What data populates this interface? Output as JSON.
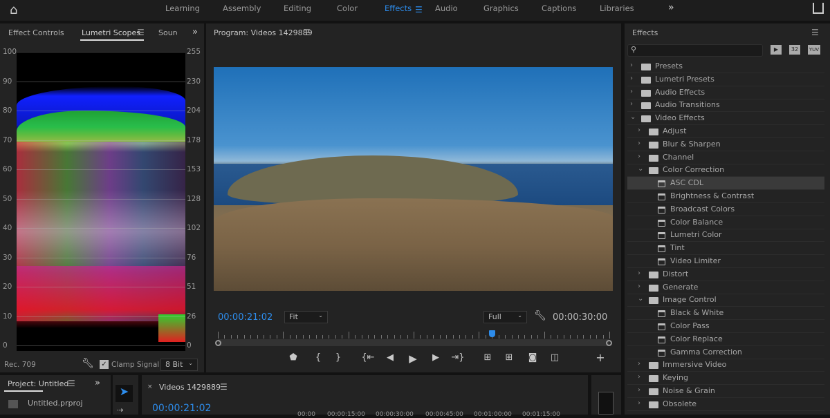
{
  "topbar": {
    "workspaces": [
      "Learning",
      "Assembly",
      "Editing",
      "Color",
      "Effects",
      "Audio",
      "Graphics",
      "Captions",
      "Libraries"
    ],
    "active": "Effects",
    "overflow": "»"
  },
  "left_panel": {
    "tabs": [
      "Effect Controls",
      "Lumetri Scopes",
      "Sourc"
    ],
    "active_tab": "Lumetri Scopes",
    "left_axis": [
      "100",
      "90",
      "80",
      "70",
      "60",
      "50",
      "40",
      "30",
      "20",
      "10",
      "0"
    ],
    "right_axis": [
      "255",
      "230",
      "204",
      "178",
      "153",
      "128",
      "102",
      "76",
      "51",
      "26",
      "0"
    ],
    "colorspace": "Rec. 709",
    "clamp_label": "Clamp Signal",
    "clamp_checked": true,
    "bit_depth": "8 Bit"
  },
  "program": {
    "title": "Program: Videos 1429889",
    "current_time": "00:00:21:02",
    "zoom": "Fit",
    "quality": "Full",
    "duration": "00:00:30:00",
    "playhead_fraction": 0.7
  },
  "project": {
    "title": "Project: Untitled",
    "file": "Untitled.prproj"
  },
  "timeline": {
    "title": "Videos 1429889",
    "timecode": "00:00:21:02",
    "ruler": [
      "00:00",
      "00:00:15:00",
      "00:00:30:00",
      "00:00:45:00",
      "00:01:00:00",
      "00:01:15:00"
    ]
  },
  "effects": {
    "title": "Effects",
    "badges": [
      "32",
      "YUV"
    ],
    "items": [
      {
        "label": "Presets",
        "level": 0,
        "type": "star-folder",
        "open": false
      },
      {
        "label": "Lumetri Presets",
        "level": 0,
        "type": "star-folder",
        "open": false
      },
      {
        "label": "Audio Effects",
        "level": 0,
        "type": "folder",
        "open": false
      },
      {
        "label": "Audio Transitions",
        "level": 0,
        "type": "folder",
        "open": false
      },
      {
        "label": "Video Effects",
        "level": 0,
        "type": "folder",
        "open": true
      },
      {
        "label": "Adjust",
        "level": 1,
        "type": "folder",
        "open": false
      },
      {
        "label": "Blur & Sharpen",
        "level": 1,
        "type": "folder",
        "open": false
      },
      {
        "label": "Channel",
        "level": 1,
        "type": "folder",
        "open": false
      },
      {
        "label": "Color Correction",
        "level": 1,
        "type": "folder",
        "open": true
      },
      {
        "label": "ASC CDL",
        "level": 2,
        "type": "effect",
        "selected": true
      },
      {
        "label": "Brightness & Contrast",
        "level": 2,
        "type": "effect"
      },
      {
        "label": "Broadcast Colors",
        "level": 2,
        "type": "effect"
      },
      {
        "label": "Color Balance",
        "level": 2,
        "type": "effect"
      },
      {
        "label": "Lumetri Color",
        "level": 2,
        "type": "effect"
      },
      {
        "label": "Tint",
        "level": 2,
        "type": "effect"
      },
      {
        "label": "Video Limiter",
        "level": 2,
        "type": "effect"
      },
      {
        "label": "Distort",
        "level": 1,
        "type": "folder",
        "open": false
      },
      {
        "label": "Generate",
        "level": 1,
        "type": "folder",
        "open": false
      },
      {
        "label": "Image Control",
        "level": 1,
        "type": "folder",
        "open": true
      },
      {
        "label": "Black & White",
        "level": 2,
        "type": "effect"
      },
      {
        "label": "Color Pass",
        "level": 2,
        "type": "effect"
      },
      {
        "label": "Color Replace",
        "level": 2,
        "type": "effect"
      },
      {
        "label": "Gamma Correction",
        "level": 2,
        "type": "effect"
      },
      {
        "label": "Immersive Video",
        "level": 1,
        "type": "folder",
        "open": false
      },
      {
        "label": "Keying",
        "level": 1,
        "type": "folder",
        "open": false
      },
      {
        "label": "Noise & Grain",
        "level": 1,
        "type": "folder",
        "open": false
      },
      {
        "label": "Obsolete",
        "level": 1,
        "type": "folder",
        "open": false
      }
    ]
  },
  "colors": {
    "accent": "#2d8ceb",
    "panel": "#232323"
  }
}
